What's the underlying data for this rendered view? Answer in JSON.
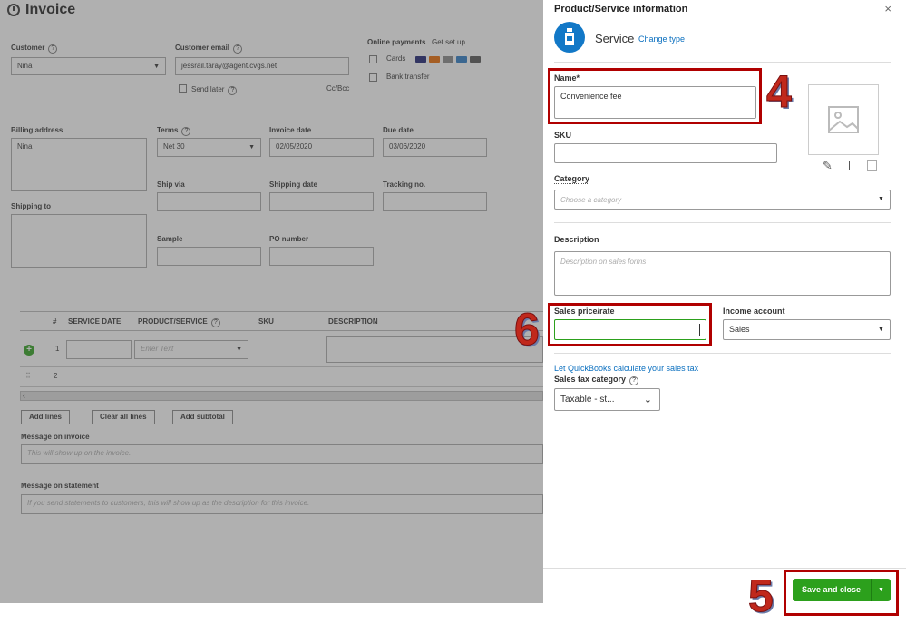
{
  "invoice": {
    "title": "Invoice",
    "customer_label": "Customer",
    "customer_value": "Nina",
    "email_label": "Customer email",
    "email_value": "jessrail.taray@agent.cvgs.net",
    "send_later": "Send later",
    "cc_bcc": "Cc/Bcc",
    "online_payments_label": "Online payments",
    "get_set_up": "Get set up",
    "cards": "Cards",
    "bank_transfer": "Bank transfer",
    "billing_address_label": "Billing address",
    "billing_address_value": "Nina",
    "terms_label": "Terms",
    "terms_value": "Net 30",
    "invoice_date_label": "Invoice date",
    "invoice_date_value": "02/05/2020",
    "due_date_label": "Due date",
    "due_date_value": "03/06/2020",
    "ship_via_label": "Ship via",
    "shipping_date_label": "Shipping date",
    "tracking_label": "Tracking no.",
    "shipping_to_label": "Shipping to",
    "sample_label": "Sample",
    "po_label": "PO number",
    "table_headers": [
      "#",
      "SERVICE DATE",
      "PRODUCT/SERVICE",
      "SKU",
      "DESCRIPTION"
    ],
    "row_numbers": [
      "1",
      "2"
    ],
    "product_placeholder": "Enter Text",
    "add_lines": "Add lines",
    "clear_all_lines": "Clear all lines",
    "add_subtotal": "Add subtotal",
    "message_invoice_label": "Message on invoice",
    "message_invoice_placeholder": "This will show up on the invoice.",
    "message_statement_label": "Message on statement",
    "message_statement_placeholder": "If you send statements to customers, this will show up as the description for this invoice."
  },
  "panel": {
    "title": "Product/Service information",
    "close": "×",
    "type_label": "Service",
    "change_type": "Change type",
    "name_label": "Name*",
    "name_value": "Convenience fee",
    "sku_label": "SKU",
    "category_label": "Category",
    "category_placeholder": "Choose a category",
    "description_label": "Description",
    "description_placeholder": "Description on sales forms",
    "sales_price_label": "Sales price/rate",
    "income_account_label": "Income account",
    "income_account_value": "Sales",
    "calc_tax_link": "Let QuickBooks calculate your sales tax",
    "tax_category_label": "Sales tax category",
    "tax_category_value": "Taxable - st...",
    "save_close": "Save and close"
  },
  "annotations": {
    "n4": "4",
    "n5": "5",
    "n6": "6",
    "color": "#b00000"
  }
}
